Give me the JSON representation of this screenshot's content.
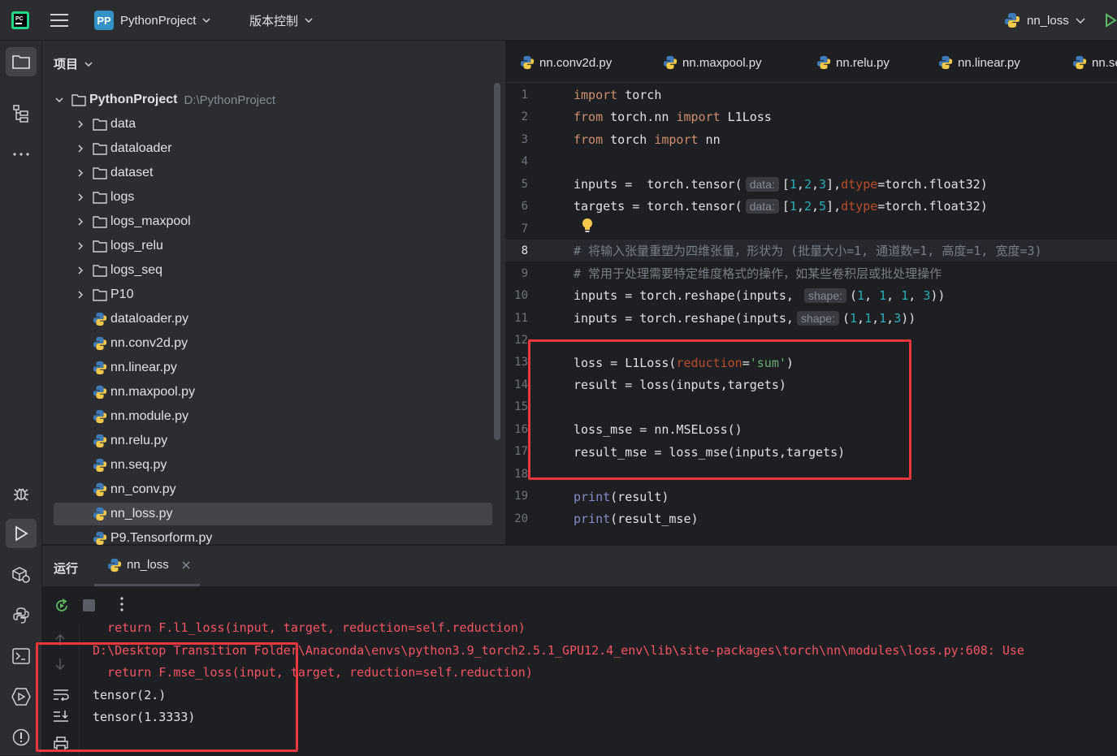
{
  "titlebar": {
    "project_badge": "PP",
    "project_name": "PythonProject",
    "vcs_label": "版本控制",
    "run_config": "nn_loss"
  },
  "project_panel": {
    "header": "项目",
    "root": {
      "name": "PythonProject",
      "path": "D:\\PythonProject"
    },
    "folders": [
      "data",
      "dataloader",
      "dataset",
      "logs",
      "logs_maxpool",
      "logs_relu",
      "logs_seq",
      "P10"
    ],
    "files": [
      "dataloader.py",
      "nn.conv2d.py",
      "nn.linear.py",
      "nn.maxpool.py",
      "nn.module.py",
      "nn.relu.py",
      "nn.seq.py",
      "nn_conv.py",
      "nn_loss.py",
      "P9.Tensorform.py"
    ],
    "selected_file": "nn_loss.py"
  },
  "editor": {
    "tabs": [
      "nn.conv2d.py",
      "nn.maxpool.py",
      "nn.relu.py",
      "nn.linear.py",
      "nn.se"
    ],
    "current_line": 8,
    "line_numbers": [
      "1",
      "2",
      "3",
      "4",
      "5",
      "6",
      "7",
      "8",
      "9",
      "10",
      "11",
      "12",
      "13",
      "14",
      "15",
      "16",
      "17",
      "18",
      "19",
      "20"
    ],
    "lines": {
      "l1_kw": "import",
      "l1_rest": " torch",
      "l2_kw1": "from",
      "l2_mid": " torch.nn ",
      "l2_kw2": "import",
      "l2_rest": " L1Loss",
      "l3_kw1": "from",
      "l3_mid": " torch ",
      "l3_kw2": "import",
      "l3_rest": " nn",
      "l5_pre": "inputs =  torch.tensor(",
      "l5_hint": "data:",
      "l5_b1": "[",
      "l5_n1": "1",
      "l5_c1": ",",
      "l5_n2": "2",
      "l5_c2": ",",
      "l5_n3": "3",
      "l5_b2": "],",
      "l5_dtype": "dtype",
      "l5_post": "=torch.float32)",
      "l6_pre": "targets = torch.tensor(",
      "l6_hint": "data:",
      "l6_b1": "[",
      "l6_n1": "1",
      "l6_c1": ",",
      "l6_n2": "2",
      "l6_c2": ",",
      "l6_n3": "5",
      "l6_b2": "],",
      "l6_dtype": "dtype",
      "l6_post": "=torch.float32)",
      "l8_comment": "# 将输入张量重塑为四维张量，形状为 (批量大小=1, 通道数=1, 高度=1, 宽度=3)",
      "l9_comment": "# 常用于处理需要特定维度格式的操作，如某些卷积层或批处理操作",
      "l10_pre": "inputs = torch.reshape(inputs, ",
      "l10_hint": "shape:",
      "l10_a": "(",
      "l10_n1": "1",
      "l10_c1": ", ",
      "l10_n2": "1",
      "l10_c2": ", ",
      "l10_n3": "1",
      "l10_c3": ", ",
      "l10_n4": "3",
      "l10_b": "))",
      "l11_pre": "inputs = torch.reshape(inputs,",
      "l11_hint": "shape:",
      "l11_a": "(",
      "l11_n1": "1",
      "l11_c1": ",",
      "l11_n2": "1",
      "l11_c2": ",",
      "l11_n3": "1",
      "l11_c3": ",",
      "l11_n4": "3",
      "l11_b": "))",
      "l13_pre": "loss = L1Loss(",
      "l13_param": "reduction",
      "l13_eq": "=",
      "l13_str": "'sum'",
      "l13_post": ")",
      "l14": "result = loss(inputs,targets)",
      "l16": "loss_mse = nn.MSELoss()",
      "l17": "result_mse = loss_mse(inputs,targets)",
      "l19_fn": "print",
      "l19_rest": "(result)",
      "l20_fn": "print",
      "l20_rest": "(result_mse)"
    }
  },
  "run_panel": {
    "title": "运行",
    "tab_name": "nn_loss",
    "output": [
      {
        "text": "  return F.l1_loss(input, target, reduction=self.reduction)",
        "kind": "err"
      },
      {
        "text": "D:\\Desktop Transition Folder\\Anaconda\\envs\\python3.9_torch2.5.1_GPU12.4_env\\lib\\site-packages\\torch\\nn\\modules\\loss.py:608: Use",
        "kind": "err"
      },
      {
        "text": "  return F.mse_loss(input, target, reduction=self.reduction)",
        "kind": "err"
      },
      {
        "text": "tensor(2.)",
        "kind": "ok"
      },
      {
        "text": "tensor(1.3333)",
        "kind": "ok"
      }
    ]
  },
  "colors": {
    "background": "#1e1f22",
    "panel": "#2b2d30",
    "keyword": "#cf8e6d",
    "number": "#2aacb8",
    "string": "#6aab73",
    "error_text": "#f75464",
    "highlight_box": "#e8383d"
  }
}
